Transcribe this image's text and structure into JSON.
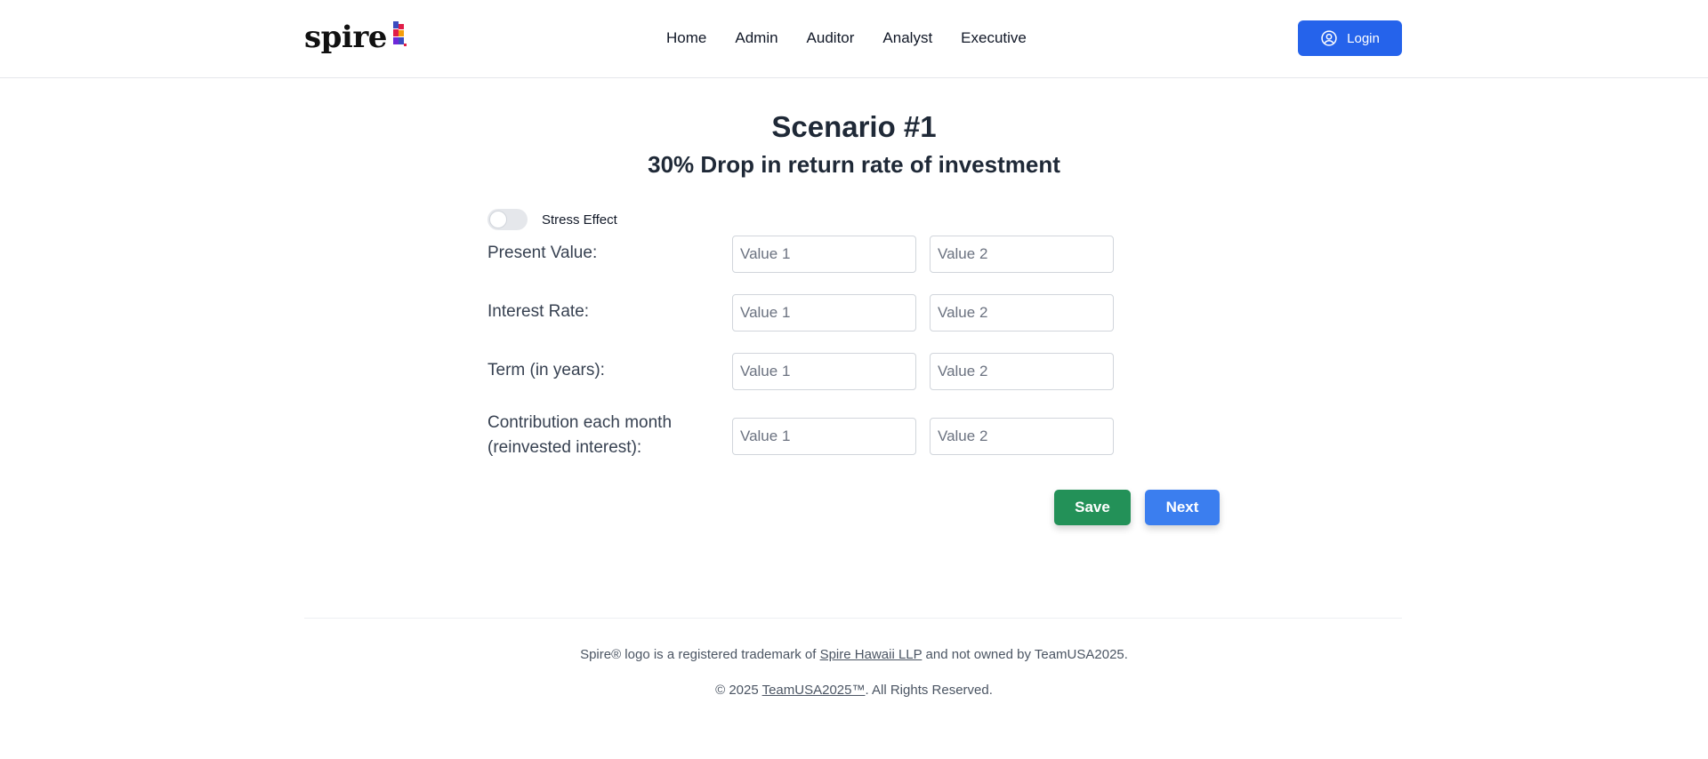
{
  "header": {
    "logo_text": "spire",
    "nav": [
      "Home",
      "Admin",
      "Auditor",
      "Analyst",
      "Executive"
    ],
    "login_label": "Login",
    "login_icon": "user-circle-icon",
    "brand_color": "#2563eb"
  },
  "main": {
    "title": "Scenario #1",
    "subtitle": "30% Drop in return rate of investment",
    "toggle": {
      "label": "Stress Effect",
      "checked": false
    },
    "rows": [
      {
        "label": "Present Value:",
        "placeholder_1": "Value 1",
        "placeholder_2": "Value 2"
      },
      {
        "label": "Interest Rate:",
        "placeholder_1": "Value 1",
        "placeholder_2": "Value 2"
      },
      {
        "label": "Term (in years):",
        "placeholder_1": "Value 1",
        "placeholder_2": "Value 2"
      },
      {
        "label_line1": "Contribution each month",
        "label_line2": "(reinvested interest):",
        "placeholder_1": "Value 1",
        "placeholder_2": "Value 2"
      }
    ],
    "save_label": "Save",
    "next_label": "Next",
    "save_color": "#239158",
    "next_color": "#3b7eef"
  },
  "footer": {
    "line1_prefix": "Spire® logo is a registered trademark of ",
    "line1_link": "Spire Hawaii LLP",
    "line1_suffix": " and not owned by TeamUSA2025.",
    "line2_prefix": "© 2025 ",
    "line2_link": "TeamUSA2025™",
    "line2_suffix": ". All Rights Reserved."
  }
}
